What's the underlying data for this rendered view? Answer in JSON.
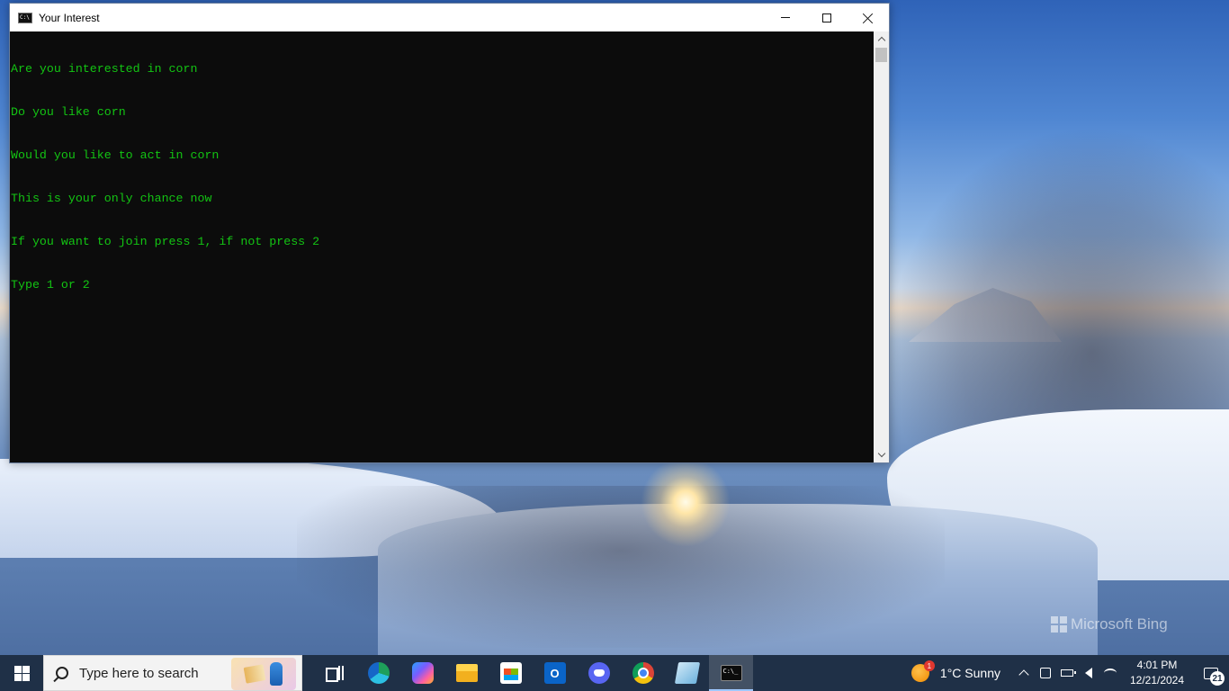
{
  "window": {
    "title": "Your Interest",
    "icon": "cmd-icon",
    "console_lines": [
      "Are you interested in corn",
      "Do you like corn",
      "Would you like to act in corn",
      "This is your only chance now",
      "If you want to join press 1, if not press 2",
      "Type 1 or 2"
    ],
    "text_color": "#13c413",
    "background_color": "#0c0c0c"
  },
  "desktop": {
    "watermark": "Microsoft Bing"
  },
  "taskbar": {
    "search_placeholder": "Type here to search",
    "apps": [
      {
        "name": "task-view",
        "icon": "taskview-icon"
      },
      {
        "name": "edge",
        "icon": "edge-icon"
      },
      {
        "name": "copilot",
        "icon": "copilot-icon"
      },
      {
        "name": "file-explorer",
        "icon": "folder-icon"
      },
      {
        "name": "microsoft-store",
        "icon": "store-icon"
      },
      {
        "name": "outlook",
        "icon": "outlook-icon",
        "label": "O"
      },
      {
        "name": "discord",
        "icon": "discord-icon"
      },
      {
        "name": "chrome",
        "icon": "chrome-icon"
      },
      {
        "name": "notepad",
        "icon": "notepad-icon"
      },
      {
        "name": "command-prompt",
        "icon": "cmd-icon",
        "active": true,
        "label": "C:\\_"
      }
    ],
    "weather": {
      "badge": "1",
      "text": "1°C  Sunny"
    },
    "clock": {
      "time": "4:01 PM",
      "date": "12/21/2024"
    },
    "notifications": {
      "count": "21"
    }
  }
}
